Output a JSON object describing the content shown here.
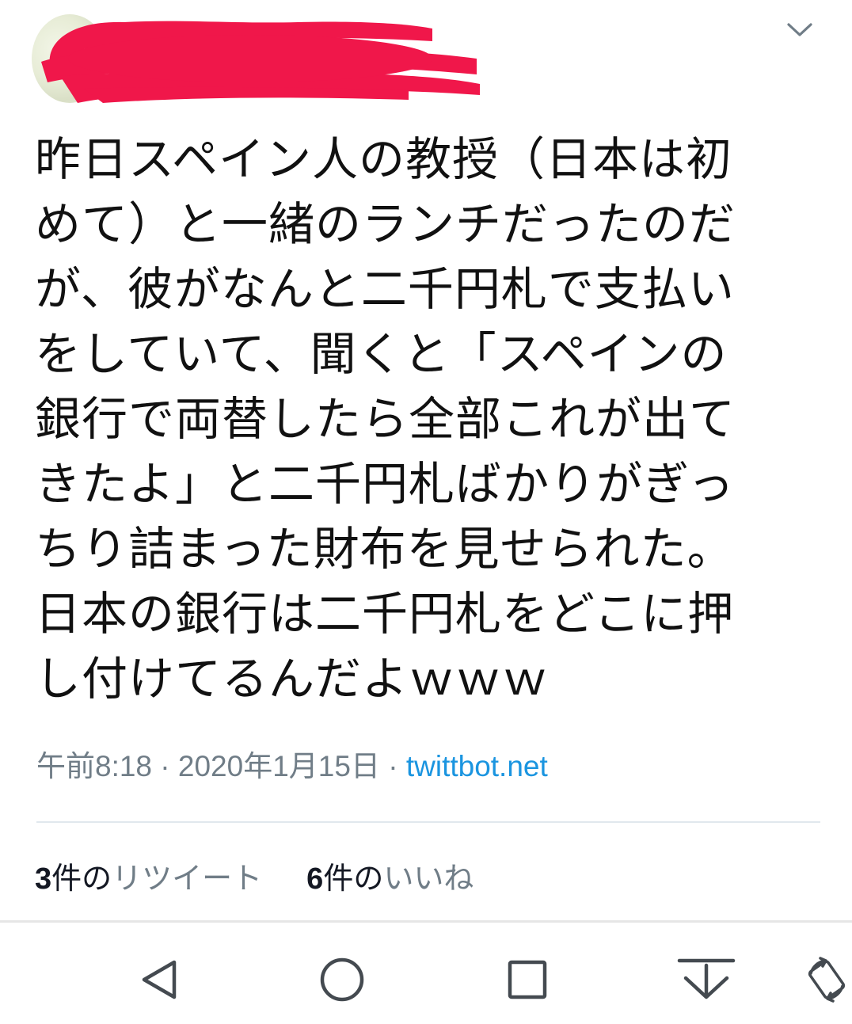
{
  "tweet": {
    "text": "昨日スペイン人の教授（日本は初めて）と一緒のランチだったのだが、彼がなんと二千円札で支払いをしていて、聞くと「スペインの銀行で両替したら全部これが出てきたよ」と二千円札ばかりがぎっちり詰まった財布を見せられた。日本の銀行は二千円札をどこに押し付けてるんだよｗｗｗ",
    "lines": [
      "昨日スペイン人の教授（日本は初",
      "めて）と一緒のランチだったのだ",
      "が、彼がなんと二千円札で支払い",
      "をしていて、聞くと「スペインの",
      "銀行で両替したら全部これが出て",
      "きたよ」と二千円札ばかりがぎっ",
      "ちり詰まった財布を見せられた。",
      "日本の銀行は二千円札をどこに押",
      "し付けてるんだよｗｗｗ"
    ],
    "time": "午前8:18",
    "separator_1": " · ",
    "date": "2020年1月15日",
    "separator_2": " · ",
    "source": "twittbot.net"
  },
  "stats": {
    "retweets": {
      "count": "3",
      "unit": "件の",
      "label": "リツイート"
    },
    "likes": {
      "count": "6",
      "unit": "件の",
      "label": "いいね"
    }
  },
  "icons": {
    "menu": "chevron-down-icon",
    "nav_back": "back-triangle-icon",
    "nav_home": "home-circle-icon",
    "nav_recents": "recents-square-icon",
    "nav_notifications": "pull-down-icon",
    "nav_rotate": "rotate-icon"
  },
  "colors": {
    "text": "#111111",
    "meta": "#707d87",
    "link": "#1b95e0",
    "redaction": "#f0174a",
    "divider": "#e1e8ed"
  }
}
